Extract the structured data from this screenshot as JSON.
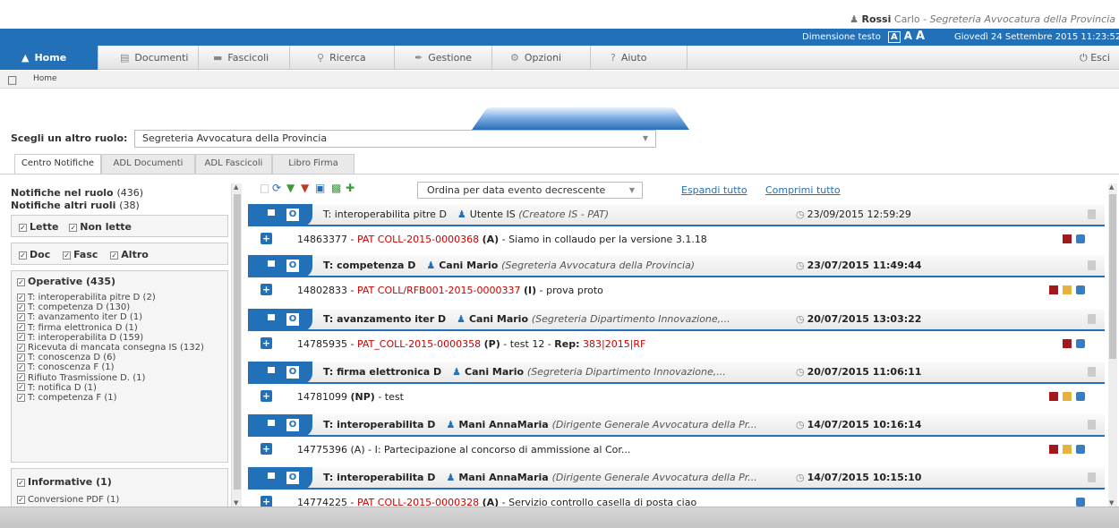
{
  "user": {
    "surname": "Rossi",
    "name": "Carlo",
    "role": "Segreteria Avvocatura della Provincia"
  },
  "bar": {
    "text_size_label": "Dimensione testo",
    "sizes": [
      "A",
      "A",
      "A"
    ],
    "datetime": "Giovedì 24 Settembre 2015 11:23:52"
  },
  "menu": {
    "items": [
      {
        "label": "Home",
        "icon": "home-icon"
      },
      {
        "label": "Documenti",
        "icon": "document-icon"
      },
      {
        "label": "Fascicoli",
        "icon": "folder-icon"
      },
      {
        "label": "Ricerca",
        "icon": "search-icon"
      },
      {
        "label": "Gestione",
        "icon": "pencil-icon"
      },
      {
        "label": "Opzioni",
        "icon": "options-icon"
      },
      {
        "label": "Aiuto",
        "icon": "help-icon"
      }
    ],
    "exit": "Esci"
  },
  "breadcrumb": {
    "home": "Home"
  },
  "role": {
    "label": "Scegli un altro ruolo:",
    "selected": "Segreteria Avvocatura della Provincia"
  },
  "tabs": [
    "Centro Notifiche",
    "ADL Documenti",
    "ADL Fascicoli",
    "Libro Firma"
  ],
  "left": {
    "in_role_label": "Notifiche nel ruolo",
    "in_role_count": "(436)",
    "other_roles_label": "Notifiche altri ruoli",
    "other_roles_count": "(38)",
    "read": "Lette",
    "unread": "Non lette",
    "doc": "Doc",
    "fasc": "Fasc",
    "altro": "Altro",
    "operative_title": "Operative (435)",
    "operative_items": [
      "T: interoperabilita pitre D (2)",
      "T: competenza D (130)",
      "T: avanzamento iter D (1)",
      "T: firma elettronica D (1)",
      "T: interoperabilita D (159)",
      "Ricevuta di mancata consegna IS (132)",
      "T: conoscenza D (6)",
      "T: conoscenza F (1)",
      "Rifiuto Trasmissione D. (1)",
      "T: notifica D (1)",
      "T: competenza F (1)"
    ],
    "informative_title": "Informative (1)",
    "informative_items": [
      "Conversione PDF (1)"
    ]
  },
  "toolbar": {
    "order": "Ordina per data evento decrescente",
    "expand_all": "Espandi tutto",
    "collapse_all": "Comprimi tutto"
  },
  "notifications": [
    {
      "type": "T: interoperabilita pitre D",
      "user": "Utente IS",
      "role": "(Creatore IS - PAT)",
      "date": "23/09/2015 12:59:29",
      "bold": false,
      "id": "14863377 - ",
      "red": "PAT  COLL-2015-0000368",
      "code": "(A)",
      "desc": " - Siamo in collaudo per la versione 3.1.18",
      "rep_label": "",
      "rep": "",
      "icons": [
        "red",
        "key"
      ]
    },
    {
      "type": "T: competenza D",
      "user": "Cani Mario",
      "role": "(Segreteria Avvocatura della Provincia)",
      "date": "23/07/2015 11:49:44",
      "bold": true,
      "id": "14802833 - ",
      "red": "PAT  COLL/RFB001-2015-0000337",
      "code": "(I)",
      "desc": " - prova proto",
      "rep_label": "",
      "rep": "",
      "icons": [
        "red",
        "yellow",
        "key"
      ]
    },
    {
      "type": "T: avanzamento iter D",
      "user": "Cani Mario",
      "role": "(Segreteria Dipartimento Innovazione,...",
      "date": "20/07/2015 13:03:22",
      "bold": true,
      "id": "14785935 - ",
      "red": "PAT_COLL-2015-0000358",
      "code": "(P)",
      "desc": " - test 12 - ",
      "rep_label": "Rep:",
      "rep": " 383|2015|RF",
      "icons": [
        "red",
        "key"
      ]
    },
    {
      "type": "T: firma elettronica D",
      "user": "Cani Mario",
      "role": "(Segreteria Dipartimento Innovazione,...",
      "date": "20/07/2015 11:06:11",
      "bold": true,
      "id": "14781099 ",
      "red": "",
      "code": "(NP)",
      "desc": " - test",
      "rep_label": "",
      "rep": "",
      "icons": [
        "red",
        "yellow",
        "key"
      ]
    },
    {
      "type": "T: interoperabilita D",
      "user": "Mani AnnaMaria",
      "role": "(Dirigente Generale Avvocatura della Pr...",
      "date": "14/07/2015 10:16:14",
      "bold": true,
      "id": "14775396 ",
      "red": "",
      "code": "(A)",
      "desc": " - I: Partecipazione al concorso di ammissione al Cor...",
      "rep_label": "",
      "rep": "",
      "icons": [
        "red",
        "yellow",
        "key"
      ]
    },
    {
      "type": "T: interoperabilita D",
      "user": "Mani AnnaMaria",
      "role": "(Dirigente Generale Avvocatura della Pr...",
      "date": "14/07/2015 10:15:10",
      "bold": true,
      "id": "14774225 - ",
      "red": "PAT  COLL-2015-0000328",
      "code": "(A)",
      "desc": " - Servizio controllo casella di posta ciao",
      "rep_label": "",
      "rep": "",
      "icons": [
        "key"
      ]
    }
  ]
}
